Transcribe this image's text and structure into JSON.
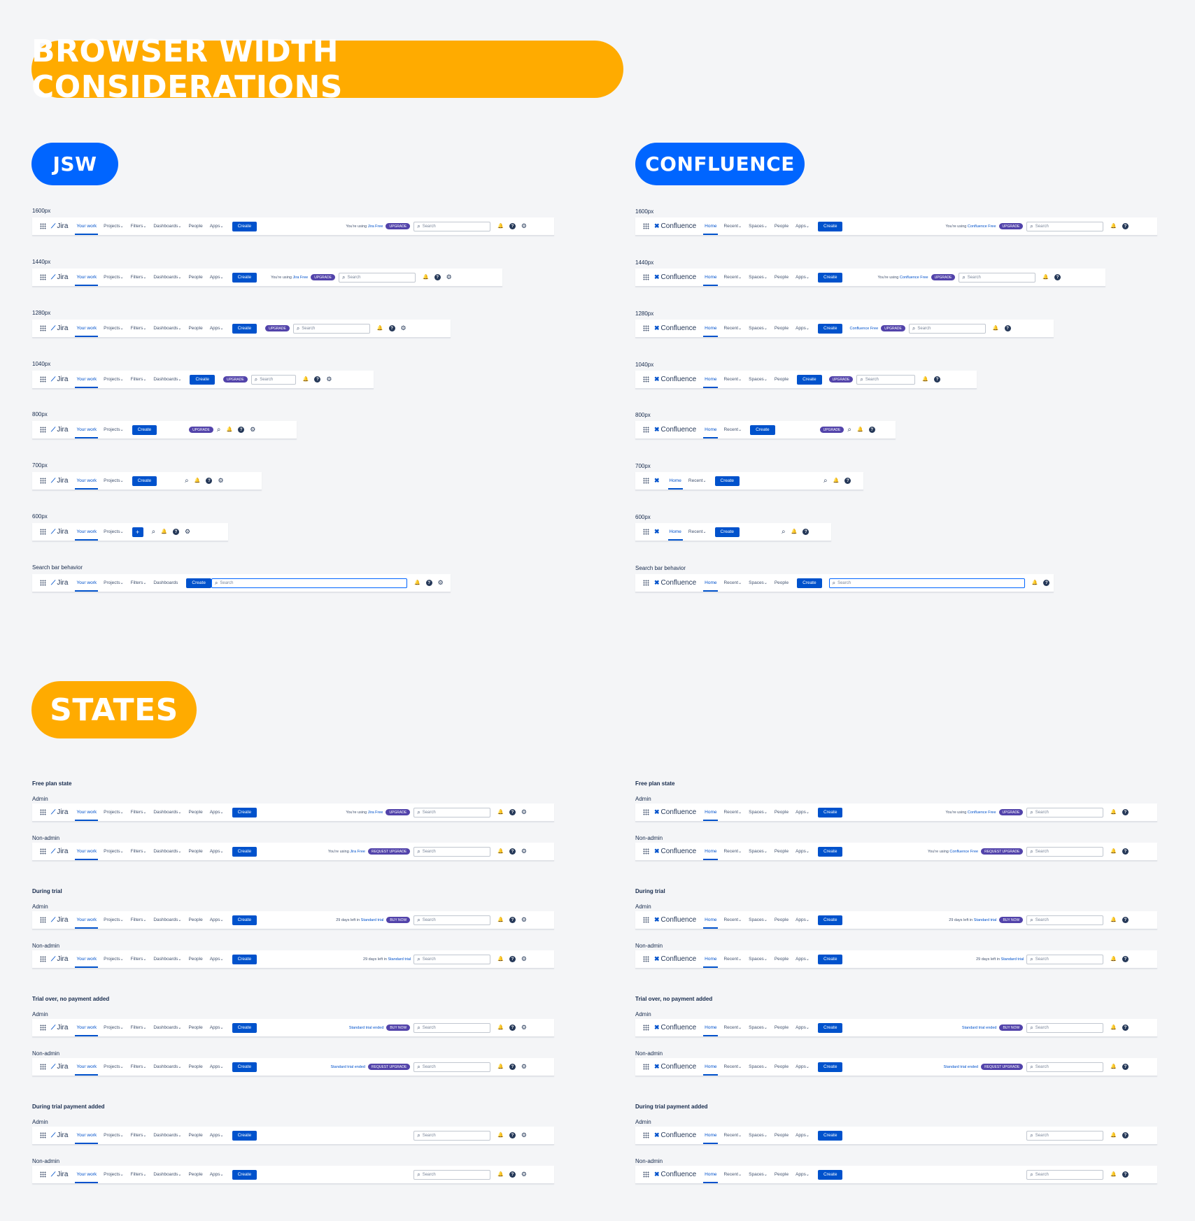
{
  "headings": {
    "main": "BROWSER WIDTH CONSIDERATIONS",
    "jsw": "JSW",
    "confluence": "CONFLUENCE",
    "states": "STATES"
  },
  "width_labels": [
    "1600px",
    "1440px",
    "1280px",
    "1040px",
    "800px",
    "700px",
    "600px",
    "Search bar behavior"
  ],
  "state_sections": [
    "Free plan state",
    "During trial",
    "Trial over, no payment added",
    "During trial payment added"
  ],
  "roles": {
    "admin": "Admin",
    "nonadmin": "Non-admin"
  },
  "jira": {
    "logo": "Jira",
    "nav": {
      "your_work": "Your work",
      "projects": "Projects",
      "filters": "Filters",
      "dashboards": "Dashboards",
      "people": "People",
      "apps": "Apps"
    },
    "create": "Create",
    "create_short": "+",
    "search": "Search",
    "using_pre": "You're using",
    "plan": "Jira Free"
  },
  "confluence": {
    "logo": "Confluence",
    "nav": {
      "home": "Home",
      "recent": "Recent",
      "spaces": "Spaces",
      "people": "People",
      "apps": "Apps"
    },
    "create": "Create",
    "search": "Search",
    "using_pre": "You're using",
    "plan": "Confluence Free"
  },
  "badges": {
    "upgrade": "UPGRADE",
    "request_upgrade": "REQUEST UPGRADE",
    "buy_now": "BUY NOW"
  },
  "trial": {
    "days_left": "29 days left in",
    "plan": "Standard trial",
    "ended": "Standard trial ended"
  },
  "icons": {
    "grid": "app-switcher-icon",
    "notifications": "notification-icon",
    "help": "help-icon",
    "settings": "gear-icon",
    "search": "search-icon"
  },
  "colors": {
    "orange": "#ffab00",
    "blue": "#0065ff",
    "create": "#0052cc",
    "badge": "#5243aa"
  }
}
